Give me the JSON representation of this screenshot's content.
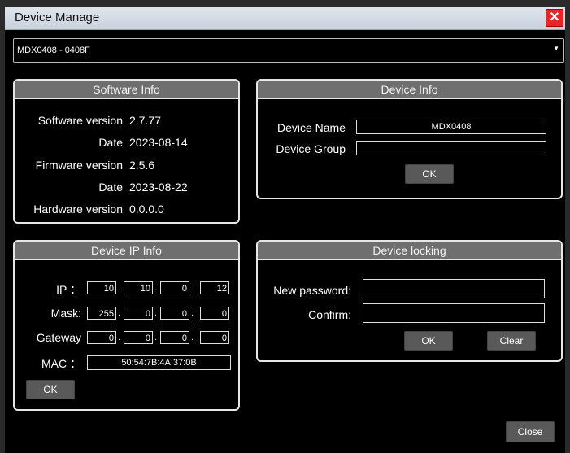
{
  "window": {
    "title": "Device Manage",
    "close_glyph": "✕"
  },
  "device_selector": {
    "value": "MDX0408 - 0408F"
  },
  "software_info": {
    "heading": "Software Info",
    "rows": [
      {
        "label": "Software version",
        "value": "2.7.77"
      },
      {
        "label": "Date",
        "value": "2023-08-14"
      },
      {
        "label": "Firmware version",
        "value": "2.5.6"
      },
      {
        "label": "Date",
        "value": "2023-08-22"
      },
      {
        "label": "Hardware version",
        "value": "0.0.0.0"
      }
    ]
  },
  "device_info": {
    "heading": "Device Info",
    "name_label": "Device Name",
    "name_value": "MDX0408",
    "group_label": "Device Group",
    "group_value": "",
    "ok_label": "OK"
  },
  "device_ip_info": {
    "heading": "Device IP Info",
    "ip_label": "IP ：",
    "ip": [
      "10",
      "10",
      "0",
      "12"
    ],
    "mask_label": "Mask:",
    "mask": [
      "255",
      "0",
      "0",
      "0"
    ],
    "gateway_label": "Gateway",
    "gateway": [
      "0",
      "0",
      "0",
      "0"
    ],
    "mac_label": "MAC ：",
    "mac": "50:54:7B:4A:37:0B",
    "ok_label": "OK"
  },
  "device_locking": {
    "heading": "Device locking",
    "new_password_label": "New password:",
    "new_password": "",
    "confirm_label": "Confirm:",
    "confirm": "",
    "ok_label": "OK",
    "clear_label": "Clear"
  },
  "footer": {
    "close_label": "Close"
  }
}
